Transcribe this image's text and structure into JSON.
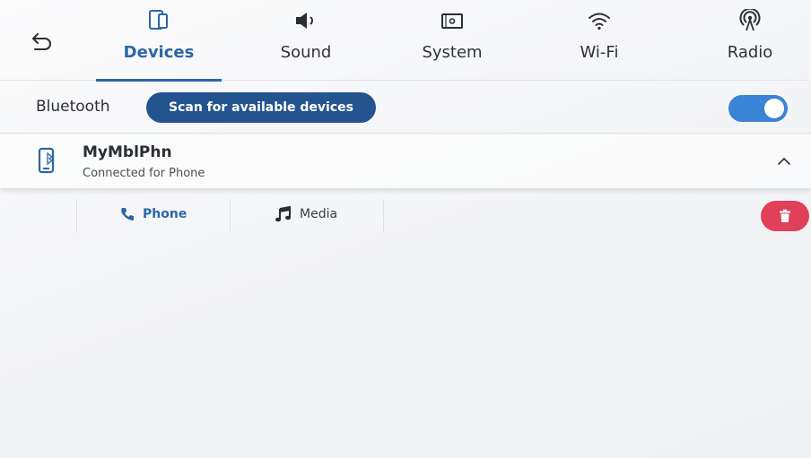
{
  "nav": {
    "tabs": [
      {
        "label": "Devices",
        "icon": "devices-icon",
        "active": true
      },
      {
        "label": "Sound",
        "icon": "speaker-icon",
        "active": false
      },
      {
        "label": "System",
        "icon": "system-icon",
        "active": false
      },
      {
        "label": "Wi-Fi",
        "icon": "wifi-icon",
        "active": false
      },
      {
        "label": "Radio",
        "icon": "radio-icon",
        "active": false
      }
    ]
  },
  "bluetooth": {
    "label": "Bluetooth",
    "scan_label": "Scan for available devices",
    "enabled": true
  },
  "device": {
    "name": "MyMblPhn",
    "status": "Connected for Phone",
    "expanded": true,
    "profiles": [
      {
        "label": "Phone",
        "icon": "phone-icon",
        "active": true
      },
      {
        "label": "Media",
        "icon": "music-note-icon",
        "active": false
      }
    ]
  },
  "colors": {
    "accent": "#2b66a8",
    "scan_button": "#24548f",
    "toggle_on": "#3b83d6",
    "delete": "#e0405a"
  }
}
